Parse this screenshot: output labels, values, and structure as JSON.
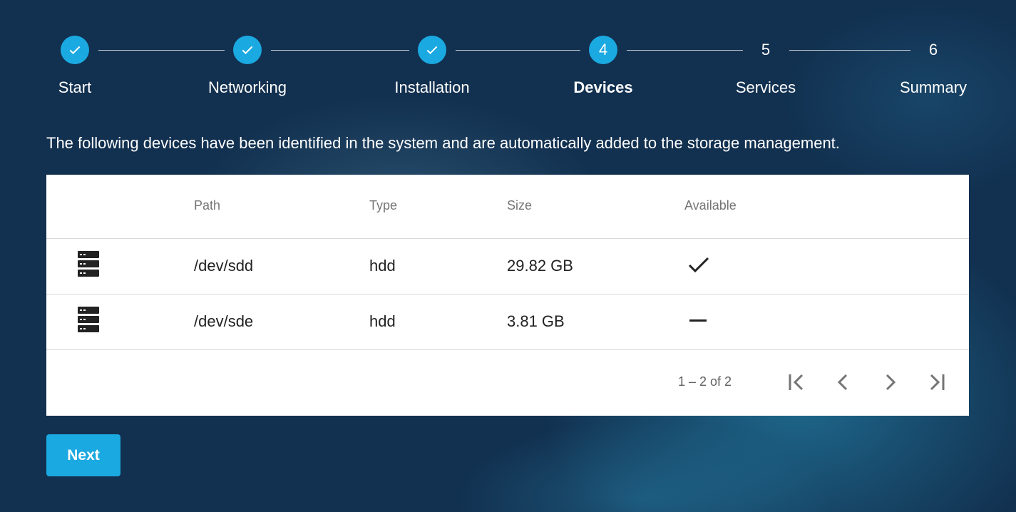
{
  "stepper": {
    "steps": [
      {
        "label": "Start",
        "marker": "",
        "state": "done"
      },
      {
        "label": "Networking",
        "marker": "",
        "state": "done"
      },
      {
        "label": "Installation",
        "marker": "",
        "state": "done"
      },
      {
        "label": "Devices",
        "marker": "4",
        "state": "active"
      },
      {
        "label": "Services",
        "marker": "5",
        "state": "pending"
      },
      {
        "label": "Summary",
        "marker": "6",
        "state": "pending"
      }
    ]
  },
  "intro_text": "The following devices have been identified in the system and are automatically added to the storage management.",
  "table": {
    "columns": [
      "",
      "Path",
      "Type",
      "Size",
      "Available"
    ],
    "rows": [
      {
        "icon": "storage-icon",
        "path": "/dev/sdd",
        "type": "hdd",
        "size": "29.82 GB",
        "available": true,
        "available_icon": "check-icon"
      },
      {
        "icon": "storage-icon",
        "path": "/dev/sde",
        "type": "hdd",
        "size": "3.81 GB",
        "available": false,
        "available_icon": "dash-icon"
      }
    ]
  },
  "paginator": {
    "range_label": "1 – 2 of 2",
    "icons": [
      "first-page-icon",
      "previous-page-icon",
      "next-page-icon",
      "last-page-icon"
    ]
  },
  "actions": {
    "next_label": "Next"
  },
  "colors": {
    "accent": "#1ba9e1",
    "background": "#12304f"
  }
}
